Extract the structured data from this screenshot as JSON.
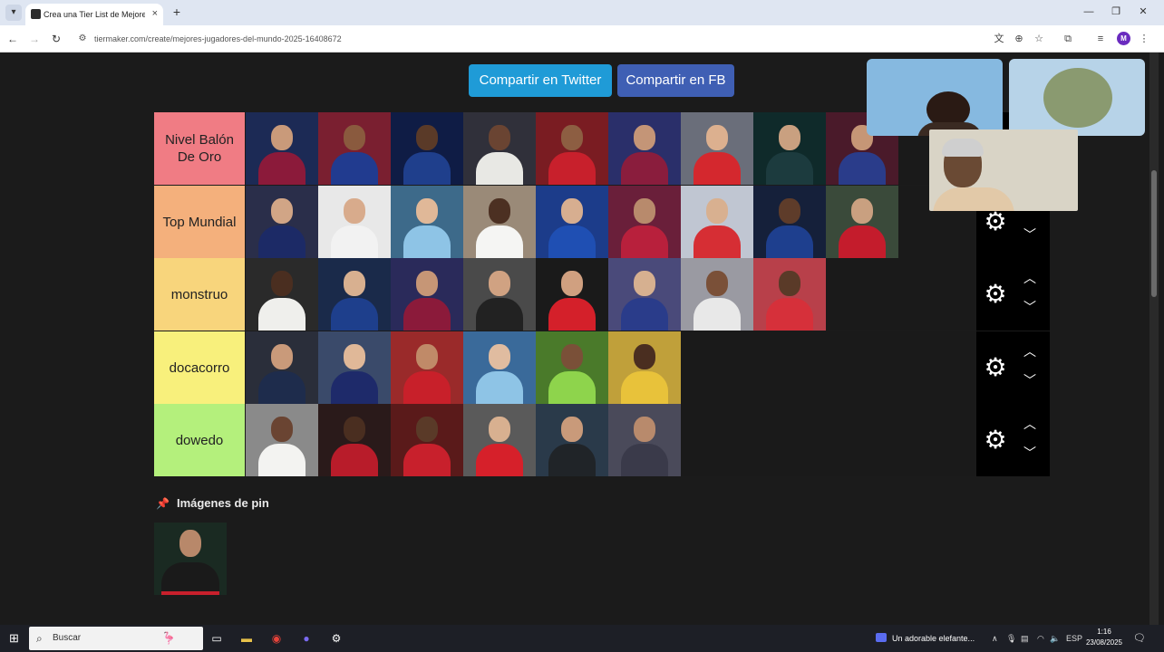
{
  "browser": {
    "tab_title": "Crea una Tier List de Mejores jugadores",
    "tab_close": "×",
    "new_tab": "+",
    "url": "tiermaker.com/create/mejores-jugadores-del-mundo-2025-16408672",
    "profile_initial": "M"
  },
  "share": {
    "twitter_label": "Compartir en Twitter",
    "facebook_label": "Compartir en FB"
  },
  "tiers": [
    {
      "label": "Nivel Balón De Oro",
      "color": "#f07c84",
      "items": [
        {
          "bg": "#1c2a55",
          "kit": "#8b1a3a",
          "skin": "#c99a7a"
        },
        {
          "bg": "#7a1f30",
          "kit": "#213b8f",
          "skin": "#8a5a3e"
        },
        {
          "bg": "#0f1c45",
          "kit": "#1f3f8c",
          "skin": "#5a3a28"
        },
        {
          "bg": "#30303a",
          "kit": "#e8e8e4",
          "skin": "#6a4432"
        },
        {
          "bg": "#7a1c22",
          "kit": "#c8202c",
          "skin": "#8d5e42"
        },
        {
          "bg": "#2a2f6a",
          "kit": "#8a1d3d",
          "skin": "#c49577"
        },
        {
          "bg": "#6a6e7a",
          "kit": "#d4282e",
          "skin": "#dcb08f"
        },
        {
          "bg": "#0f2a2a",
          "kit": "#1c3b3e",
          "skin": "#c9a080"
        },
        {
          "bg": "#4a1a2a",
          "kit": "#2a3c8a",
          "skin": "#c69676"
        }
      ]
    },
    {
      "label": "Top Mundial",
      "color": "#f4b07c",
      "items": [
        {
          "bg": "#2a2e4a",
          "kit": "#1c2a66",
          "skin": "#d1a586"
        },
        {
          "bg": "#e8e8e8",
          "kit": "#f2f2f2",
          "skin": "#d8ab8c"
        },
        {
          "bg": "#3d6a8a",
          "kit": "#8ec4e6",
          "skin": "#e0b898"
        },
        {
          "bg": "#9a8a78",
          "kit": "#f5f5f3",
          "skin": "#4c3022"
        },
        {
          "bg": "#1c3c8a",
          "kit": "#1f4fb3",
          "skin": "#d7ae90"
        },
        {
          "bg": "#6a1f3a",
          "kit": "#b8203c",
          "skin": "#b88a6c"
        },
        {
          "bg": "#c0c6d2",
          "kit": "#d62e34",
          "skin": "#d8b090"
        },
        {
          "bg": "#15203a",
          "kit": "#1e3f8e",
          "skin": "#5e3c2a"
        },
        {
          "bg": "#3a4a3a",
          "kit": "#c41c2c",
          "skin": "#c9a080"
        }
      ]
    },
    {
      "label": "monstruo",
      "color": "#f8d57c",
      "items": [
        {
          "bg": "#2a2a2a",
          "kit": "#efefec",
          "skin": "#4a2e20"
        },
        {
          "bg": "#1a2a4a",
          "kit": "#1e3f8c",
          "skin": "#d8b090"
        },
        {
          "bg": "#2a2a5a",
          "kit": "#8b1a3a",
          "skin": "#c69676"
        },
        {
          "bg": "#4a4a4a",
          "kit": "#222222",
          "skin": "#d0a282"
        },
        {
          "bg": "#1a1a1a",
          "kit": "#d4202a",
          "skin": "#d0a080"
        },
        {
          "bg": "#4a4a7a",
          "kit": "#2a3c8a",
          "skin": "#d6b090"
        },
        {
          "bg": "#9a9aa2",
          "kit": "#e8e8e8",
          "skin": "#7a5038"
        },
        {
          "bg": "#b8404a",
          "kit": "#d6303a",
          "skin": "#5a3a28"
        }
      ]
    },
    {
      "label": "docacorro",
      "color": "#f8f07c",
      "items": [
        {
          "bg": "#2a2e3a",
          "kit": "#1e2c4c",
          "skin": "#c99a7a"
        },
        {
          "bg": "#3a4a6a",
          "kit": "#1e2a6a",
          "skin": "#e0b898"
        },
        {
          "bg": "#9a2a2a",
          "kit": "#c8202a",
          "skin": "#c08a68"
        },
        {
          "bg": "#3a6a9a",
          "kit": "#8ec4e6",
          "skin": "#e0bca0"
        },
        {
          "bg": "#4a7a2a",
          "kit": "#8ed44c",
          "skin": "#7a5038"
        },
        {
          "bg": "#c0a03a",
          "kit": "#e8c23a",
          "skin": "#4a2e20"
        }
      ]
    },
    {
      "label": "dowedo",
      "color": "#b4f07c",
      "items": [
        {
          "bg": "#8a8a8a",
          "kit": "#f3f3f1",
          "skin": "#6a4432"
        },
        {
          "bg": "#2a1a1a",
          "kit": "#b81c2a",
          "skin": "#4a2e20"
        },
        {
          "bg": "#5a1a1a",
          "kit": "#c8202c",
          "skin": "#5a3a28"
        },
        {
          "bg": "#5a5a5a",
          "kit": "#d6202a",
          "skin": "#d8b090"
        },
        {
          "bg": "#2a3a4a",
          "kit": "#202428",
          "skin": "#c99a7a"
        },
        {
          "bg": "#4a4a5a",
          "kit": "#3a3a4a",
          "skin": "#b88a6c"
        }
      ]
    }
  ],
  "pin_section": {
    "title": "Imágenes de pin",
    "item": {
      "bg": "#1a2a22",
      "kit": "#1a1a1a",
      "skin": "#b8886a"
    }
  },
  "taskbar": {
    "search_placeholder": "Buscar",
    "media_title": "Un adorable elefante...",
    "lang": "ESP",
    "time": "1:16",
    "date": "23/08/2025"
  }
}
